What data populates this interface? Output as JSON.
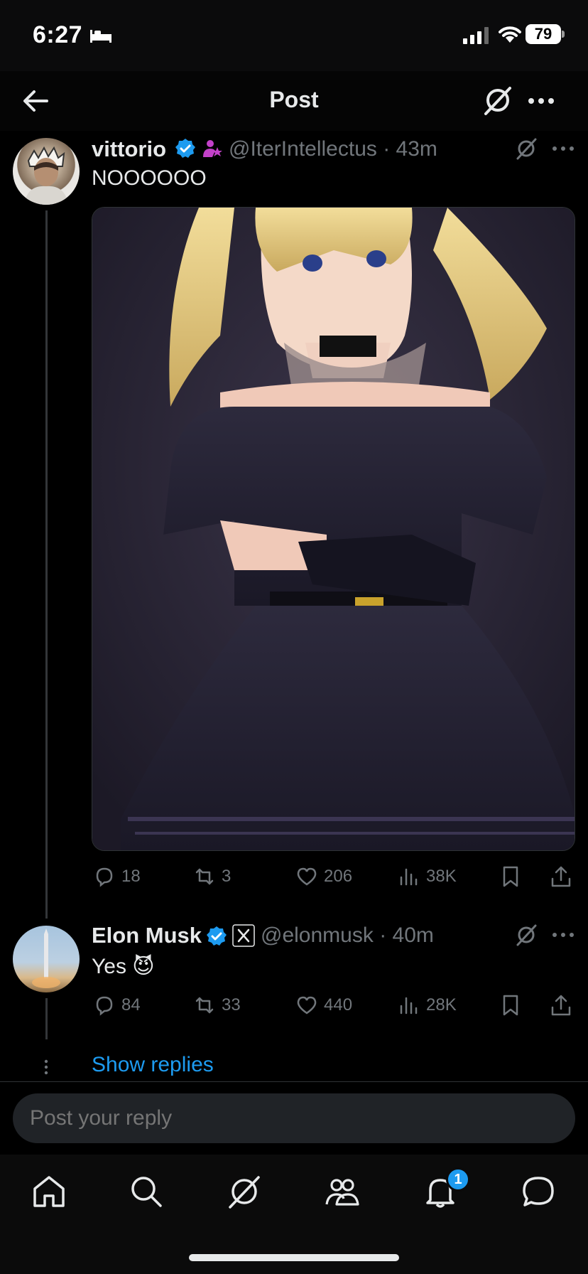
{
  "status_bar": {
    "time": "6:27",
    "battery": "79",
    "icons": [
      "bed-icon",
      "signal-icon",
      "wifi-icon",
      "battery-icon"
    ]
  },
  "header": {
    "title": "Post",
    "icons": [
      "back-arrow-icon",
      "grok-icon",
      "more-icon"
    ]
  },
  "tweets": [
    {
      "name": "vittorio",
      "handle": "@IterIntellectus",
      "time": "· 43m",
      "text": "NOOOOOO",
      "has_image": true,
      "stats": {
        "replies": "18",
        "reposts": "3",
        "likes": "206",
        "views": "38K"
      }
    },
    {
      "name": "Elon Musk",
      "handle": "@elonmusk",
      "time": "· 40m",
      "text": "Yes 😈",
      "has_image": false,
      "stats": {
        "replies": "84",
        "reposts": "33",
        "likes": "440",
        "views": "28K"
      }
    }
  ],
  "show_replies": "Show replies",
  "reply": {
    "placeholder": "Post your reply"
  },
  "tabbar": {
    "items": [
      "home-icon",
      "search-icon",
      "grok-icon",
      "communities-icon",
      "notifications-icon",
      "messages-icon"
    ],
    "notification_count": "1"
  },
  "colors": {
    "accent": "#1d9bf0",
    "background": "#000000",
    "muted_text": "#71767b",
    "text": "#e7e9ea"
  }
}
